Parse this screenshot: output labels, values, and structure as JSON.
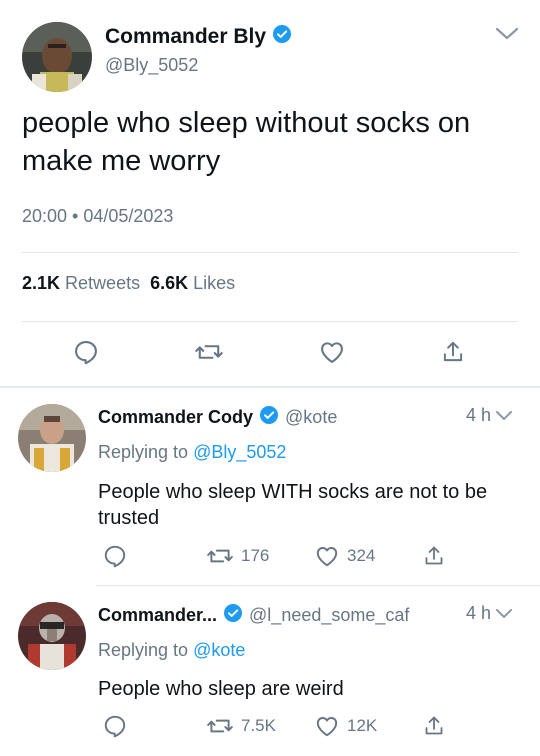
{
  "main_tweet": {
    "display_name": "Commander Bly",
    "handle": "@Bly_5052",
    "text": "people who sleep without socks on make me worry",
    "timestamp": "20:00 • 04/05/2023",
    "retweets_count": "2.1K",
    "retweets_label": "Retweets",
    "likes_count": "6.6K",
    "likes_label": "Likes",
    "verified": true
  },
  "replies": [
    {
      "display_name": "Commander Cody",
      "handle": "@kote",
      "time": "4 h",
      "replying_prefix": "Replying to",
      "replying_to": "@Bly_5052",
      "text": "People who sleep WITH socks are not to be trusted",
      "retweets": "176",
      "likes": "324"
    },
    {
      "display_name": "Commander...",
      "handle": "@l_need_some_caf",
      "time": "4 h",
      "replying_prefix": "Replying to",
      "replying_to": "@kote",
      "text": "People who sleep are weird",
      "retweets": "7.5K",
      "likes": "12K"
    }
  ],
  "colors": {
    "accent": "#1d9bf0",
    "secondary_text": "#687684",
    "divider": "#e1e8ed"
  },
  "icons": [
    "chevron-down-icon",
    "verified-badge-icon",
    "reply-icon",
    "retweet-icon",
    "like-icon",
    "share-icon"
  ]
}
